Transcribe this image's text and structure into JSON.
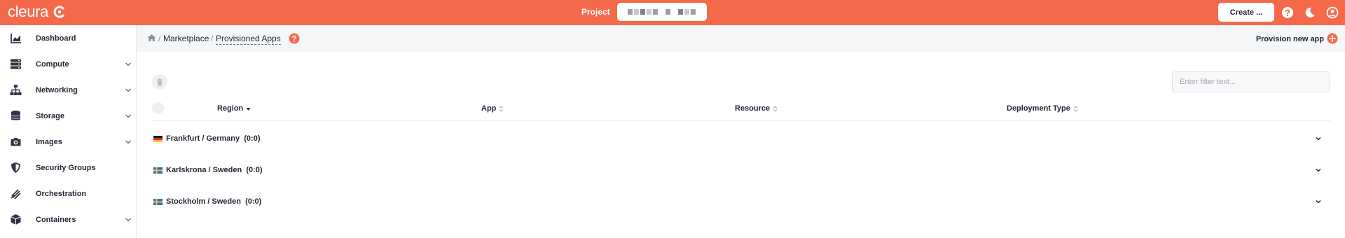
{
  "brand": {
    "name": "cleura",
    "accent": "#f5694b"
  },
  "topbar": {
    "project_label": "Project",
    "create_label": "Create ...",
    "icons": [
      "help-icon",
      "dark-mode-icon",
      "user-icon"
    ]
  },
  "sidebar": {
    "items": [
      {
        "label": "Dashboard",
        "icon": "chart-icon",
        "expandable": false
      },
      {
        "label": "Compute",
        "icon": "server-icon",
        "expandable": true
      },
      {
        "label": "Networking",
        "icon": "network-icon",
        "expandable": true
      },
      {
        "label": "Storage",
        "icon": "database-icon",
        "expandable": true
      },
      {
        "label": "Images",
        "icon": "camera-icon",
        "expandable": true
      },
      {
        "label": "Security Groups",
        "icon": "shield-icon",
        "expandable": false
      },
      {
        "label": "Orchestration",
        "icon": "orchestration-icon",
        "expandable": false
      },
      {
        "label": "Containers",
        "icon": "cube-icon",
        "expandable": true
      }
    ]
  },
  "breadcrumb": {
    "items": [
      "Marketplace",
      "Provisioned Apps"
    ],
    "separator": "/"
  },
  "actions": {
    "provision_label": "Provision new app"
  },
  "filter": {
    "placeholder": "Enter filter text..."
  },
  "table": {
    "columns": [
      {
        "label": "Region",
        "sort": "desc"
      },
      {
        "label": "App",
        "sort": "none"
      },
      {
        "label": "Resource",
        "sort": "none"
      },
      {
        "label": "Deployment Type",
        "sort": "none"
      }
    ],
    "groups": [
      {
        "label": "Frankfurt / Germany",
        "count": "(0:0)",
        "flag": "de"
      },
      {
        "label": "Karlskrona / Sweden",
        "count": "(0:0)",
        "flag": "se"
      },
      {
        "label": "Stockholm / Sweden",
        "count": "(0:0)",
        "flag": "se"
      }
    ]
  }
}
